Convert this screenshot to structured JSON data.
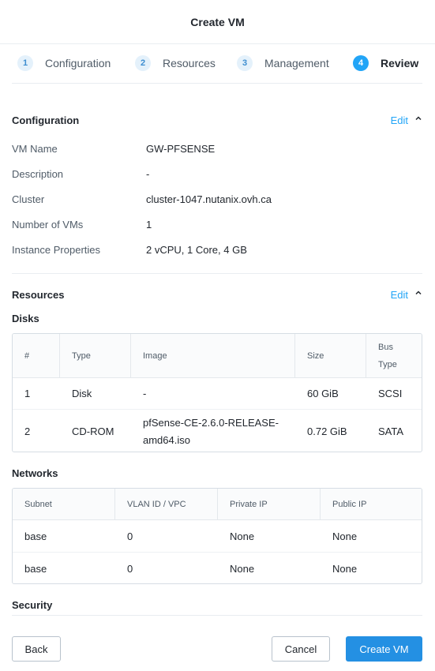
{
  "dialog": {
    "title": "Create VM"
  },
  "wizard": {
    "steps": [
      {
        "num": "1",
        "label": "Configuration"
      },
      {
        "num": "2",
        "label": "Resources"
      },
      {
        "num": "3",
        "label": "Management"
      },
      {
        "num": "4",
        "label": "Review"
      }
    ],
    "active_step": 4
  },
  "configuration": {
    "title": "Configuration",
    "edit": "Edit",
    "fields": [
      {
        "key": "VM Name",
        "value": "GW-PFSENSE"
      },
      {
        "key": "Description",
        "value": "-"
      },
      {
        "key": "Cluster",
        "value": "cluster-1047.nutanix.ovh.ca"
      },
      {
        "key": "Number of VMs",
        "value": "1"
      },
      {
        "key": "Instance Properties",
        "value": "2 vCPU, 1 Core, 4 GB"
      }
    ]
  },
  "resources": {
    "title": "Resources",
    "edit": "Edit",
    "disks": {
      "title": "Disks",
      "headers": [
        "#",
        "Type",
        "Image",
        "Size",
        "Bus",
        "Type"
      ],
      "rows": [
        {
          "num": "1",
          "type": "Disk",
          "image_line1": "-",
          "image_line2": "",
          "size": "60 GiB",
          "bus": "SCSI"
        },
        {
          "num": "2",
          "type": "CD-ROM",
          "image_line1": "pfSense-CE-2.6.0-RELEASE-",
          "image_line2": "amd64.iso",
          "size": "0.72 GiB",
          "bus": "SATA"
        }
      ]
    },
    "networks": {
      "title": "Networks",
      "headers": [
        "Subnet",
        "VLAN ID / VPC",
        "Private IP",
        "Public IP"
      ],
      "rows": [
        {
          "subnet": "base",
          "vlan": "0",
          "private_ip": "None",
          "public_ip": "None"
        },
        {
          "subnet": "base",
          "vlan": "0",
          "private_ip": "None",
          "public_ip": "None"
        }
      ]
    },
    "security": {
      "title": "Security"
    }
  },
  "footer": {
    "back": "Back",
    "cancel": "Cancel",
    "create": "Create VM"
  },
  "colors": {
    "accent": "#22a5f7",
    "primary_button": "#2490e3",
    "step_inactive_bg": "#e4f1fb"
  },
  "icons": {
    "collapse": "chevron-up-icon"
  }
}
